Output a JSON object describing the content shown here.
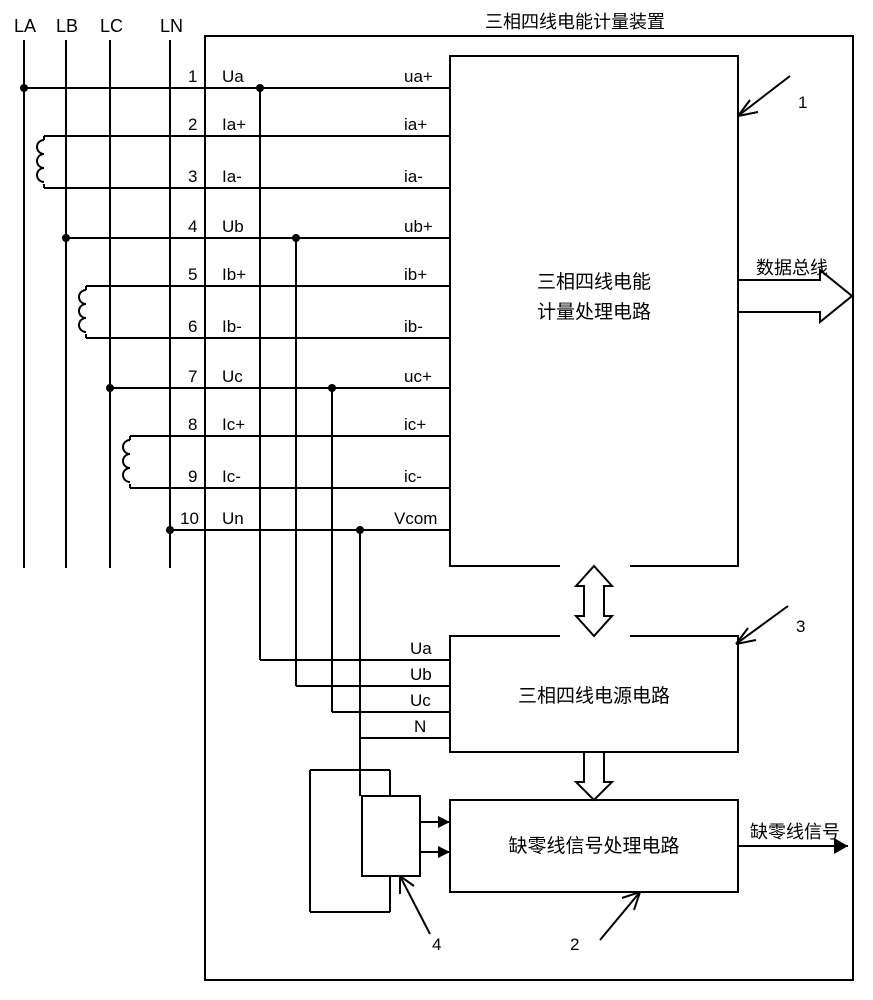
{
  "title": "三相四线电能计量装置",
  "lines": {
    "LA": "LA",
    "LB": "LB",
    "LC": "LC",
    "LN": "LN"
  },
  "terminals": {
    "t1": "1",
    "t2": "2",
    "t3": "3",
    "t4": "4",
    "t5": "5",
    "t6": "6",
    "t7": "7",
    "t8": "8",
    "t9": "9",
    "t10": "10"
  },
  "left_sig": {
    "Ua": "Ua",
    "IaP": "Ia+",
    "IaM": "Ia-",
    "Ub": "Ub",
    "IbP": "Ib+",
    "IbM": "Ib-",
    "Uc": "Uc",
    "IcP": "Ic+",
    "IcM": "Ic-",
    "Un": "Un"
  },
  "right_sig": {
    "uaP": "ua+",
    "iaP": "ia+",
    "iaM": "ia-",
    "ubP": "ub+",
    "ibP": "ib+",
    "ibM": "ib-",
    "ucP": "uc+",
    "icP": "ic+",
    "icM": "ic-",
    "Vcom": "Vcom"
  },
  "psu_in": {
    "Ua": "Ua",
    "Ub": "Ub",
    "Uc": "Uc",
    "N": "N"
  },
  "blocks": {
    "metering_l1": "三相四线电能",
    "metering_l2": "计量处理电路",
    "psu": "三相四线电源电路",
    "miss": "缺零线信号处理电路"
  },
  "outputs": {
    "databus": "数据总线",
    "miss": "缺零线信号"
  },
  "callouts": {
    "c1": "1",
    "c2": "2",
    "c3": "3",
    "c4": "4"
  }
}
